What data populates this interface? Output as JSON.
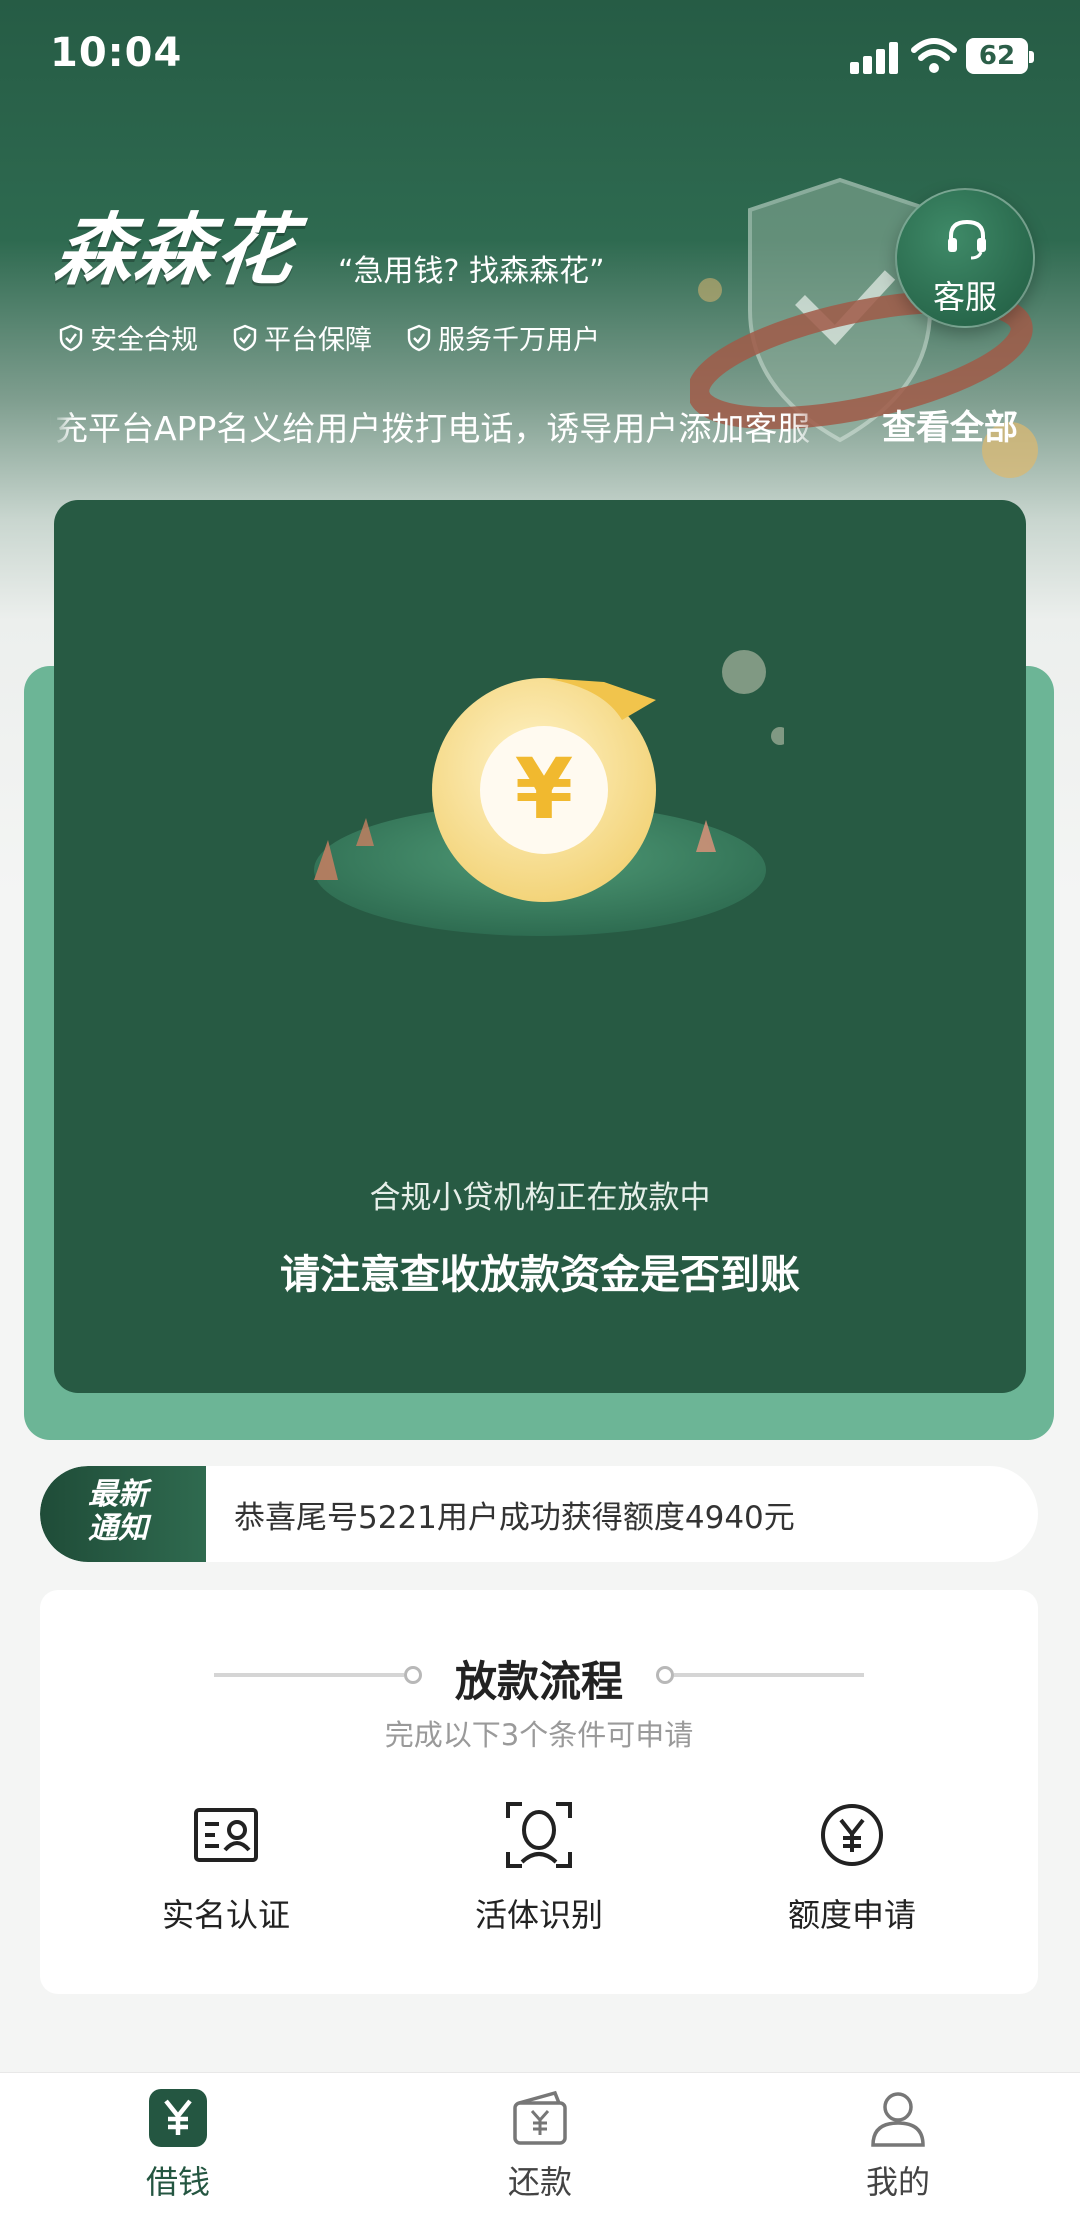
{
  "status_bar": {
    "time": "10:04",
    "battery": "62"
  },
  "header": {
    "brand": "森森花",
    "slogan": "“急用钱? 找森森花”",
    "badges": [
      "安全合规",
      "平台保障",
      "服务千万用户"
    ],
    "service_label": "客服",
    "marquee": "冒充平台APP名义给用户拨打电话，诱导用户添加客服",
    "view_all": "查看全部"
  },
  "status_card": {
    "line1": "合规小贷机构正在放款中",
    "line2": "请注意查收放款资金是否到账"
  },
  "notice": {
    "tag_line1": "最新",
    "tag_line2": "通知",
    "text": "恭喜尾号5221用户成功获得额度4940元"
  },
  "process": {
    "title": "放款流程",
    "subtitle": "完成以下3个条件可申请",
    "steps": [
      {
        "label": "实名认证",
        "icon": "id-card-icon"
      },
      {
        "label": "活体识别",
        "icon": "face-scan-icon"
      },
      {
        "label": "额度申请",
        "icon": "yuan-circle-icon"
      }
    ]
  },
  "bottom_nav": [
    {
      "label": "借钱",
      "icon": "yuan-icon",
      "active": true
    },
    {
      "label": "还款",
      "icon": "wallet-icon",
      "active": false
    },
    {
      "label": "我的",
      "icon": "profile-icon",
      "active": false
    }
  ],
  "colors": {
    "primary": "#275a43",
    "accent": "#6cb596",
    "gold": "#f3cf6a"
  }
}
